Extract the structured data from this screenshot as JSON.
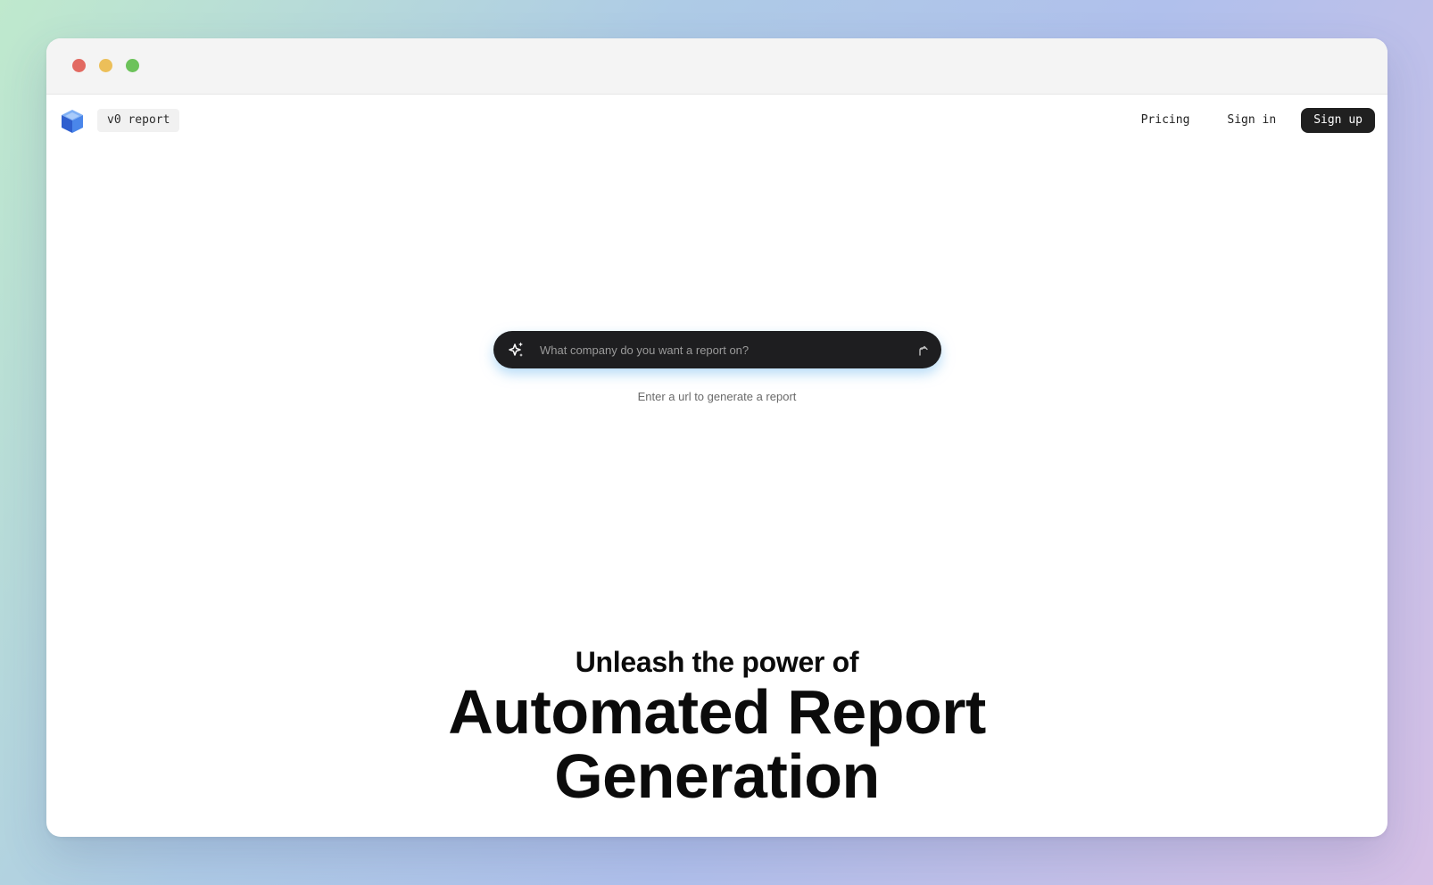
{
  "window": {
    "controls": [
      "close",
      "minimize",
      "maximize"
    ]
  },
  "navbar": {
    "logo_icon": "cube-logo-icon",
    "brand_label": "v0 report",
    "links": {
      "pricing": "Pricing",
      "sign_in": "Sign in",
      "sign_up": "Sign up"
    }
  },
  "search": {
    "icon": "sparkle-icon",
    "value": "",
    "placeholder": "What company do you want a report on?",
    "submit_icon": "arrow-up-icon",
    "hint": "Enter a url to generate a report"
  },
  "hero": {
    "subtitle": "Unleash the power of",
    "title_line1": "Automated Report",
    "title_line2": "Generation"
  },
  "colors": {
    "accent_dark": "#202020",
    "search_glow": "#78bef0",
    "window_close": "#e26a62",
    "window_minimize": "#ecbf59",
    "window_maximize": "#6cc25a",
    "logo_blue": "#3b6fd8"
  }
}
